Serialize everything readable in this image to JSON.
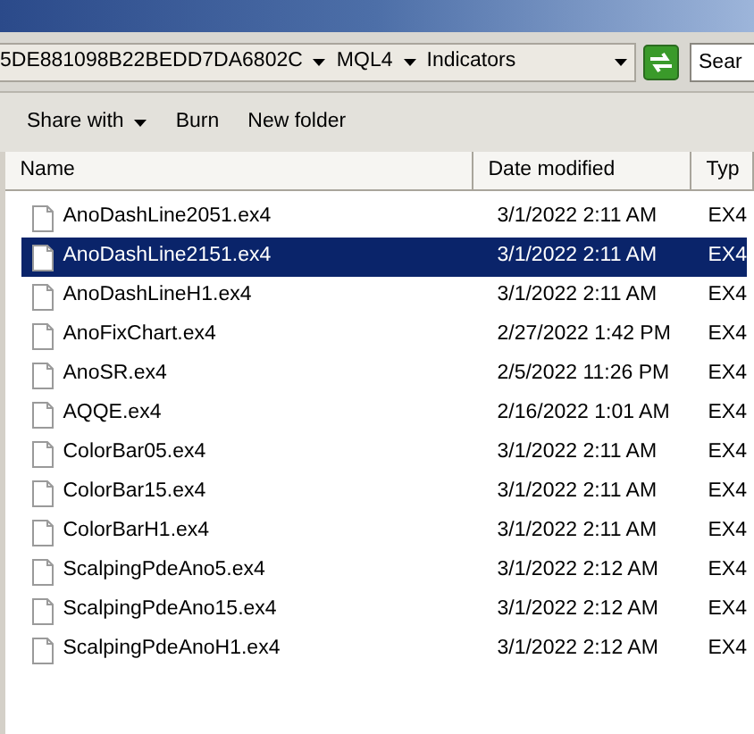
{
  "address_bar": {
    "segments": [
      {
        "label": "5DE881098B22BEDD7DA6802C"
      },
      {
        "label": "MQL4"
      },
      {
        "label": "Indicators"
      }
    ],
    "search": {
      "placeholder": "Sear"
    }
  },
  "toolbar": {
    "buttons": [
      {
        "label": "Share with",
        "kind": "menu"
      },
      {
        "label": "Burn",
        "kind": "plain"
      },
      {
        "label": "New folder",
        "kind": "plain"
      }
    ]
  },
  "table": {
    "columns": [
      "Name",
      "Date modified",
      "Typ"
    ],
    "rows": [
      {
        "name": "AnoDashLine2051.ex4",
        "date": "3/1/2022 2:11 AM",
        "type": "EX4",
        "selected": false
      },
      {
        "name": "AnoDashLine2151.ex4",
        "date": "3/1/2022 2:11 AM",
        "type": "EX4",
        "selected": true
      },
      {
        "name": "AnoDashLineH1.ex4",
        "date": "3/1/2022 2:11 AM",
        "type": "EX4",
        "selected": false
      },
      {
        "name": "AnoFixChart.ex4",
        "date": "2/27/2022 1:42 PM",
        "type": "EX4",
        "selected": false
      },
      {
        "name": "AnoSR.ex4",
        "date": "2/5/2022 11:26 PM",
        "type": "EX4",
        "selected": false
      },
      {
        "name": "AQQE.ex4",
        "date": "2/16/2022 1:01 AM",
        "type": "EX4",
        "selected": false
      },
      {
        "name": "ColorBar05.ex4",
        "date": "3/1/2022 2:11 AM",
        "type": "EX4",
        "selected": false
      },
      {
        "name": "ColorBar15.ex4",
        "date": "3/1/2022 2:11 AM",
        "type": "EX4",
        "selected": false
      },
      {
        "name": "ColorBarH1.ex4",
        "date": "3/1/2022 2:11 AM",
        "type": "EX4",
        "selected": false
      },
      {
        "name": "ScalpingPdeAno5.ex4",
        "date": "3/1/2022 2:12 AM",
        "type": "EX4",
        "selected": false
      },
      {
        "name": "ScalpingPdeAno15.ex4",
        "date": "3/1/2022 2:12 AM",
        "type": "EX4",
        "selected": false
      },
      {
        "name": "ScalpingPdeAnoH1.ex4",
        "date": "3/1/2022 2:12 AM",
        "type": "EX4",
        "selected": false
      }
    ]
  }
}
